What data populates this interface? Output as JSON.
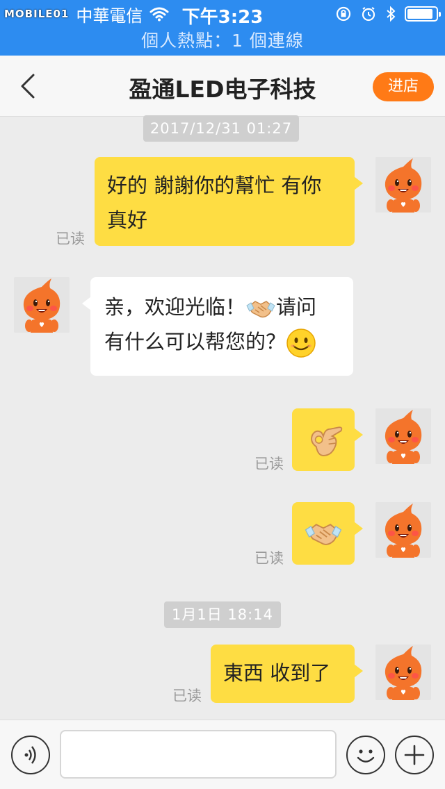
{
  "status_bar": {
    "watermark": "MOBILE01",
    "carrier": "中華電信",
    "time": "下午3:23",
    "battery_level": 0.9
  },
  "hotspot_banner": "個人熱點：1 個連線",
  "nav": {
    "title": "盈通LED电子科技",
    "enter_store_label": "进店"
  },
  "messages": [
    {
      "timestamp": "2017/12/31 01:27"
    },
    {
      "from": "me",
      "text_line1": "好的 謝謝你的幫忙 有你",
      "text_line2": "真好",
      "read": "已读"
    },
    {
      "from": "shop",
      "text_line1": "亲，欢迎光临！",
      "text_line1_after": "请问",
      "text_line2": "有什么可以帮您的？",
      "emojis": [
        "handshake-emoji",
        "smile-emoji"
      ]
    },
    {
      "from": "me",
      "emoji": "ok-hand-emoji",
      "read": "已读"
    },
    {
      "from": "me",
      "emoji": "handshake-emoji",
      "read": "已读"
    },
    {
      "timestamp": "1月1日 18:14"
    },
    {
      "from": "me",
      "text": "東西 收到了",
      "read": "已读"
    }
  ],
  "input_bar": {
    "voice_icon": "voice-icon",
    "emoji_icon": "smiley-icon",
    "plus_icon": "plus-icon",
    "input_value": ""
  },
  "colors": {
    "status_blue": "#2d8cf0",
    "bubble_yellow": "#fedd43",
    "store_orange": "#ff7a16",
    "avatar_orange": "#f4742b"
  }
}
